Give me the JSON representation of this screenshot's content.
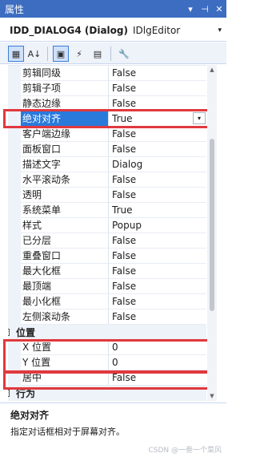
{
  "window": {
    "title": "属性",
    "btn_pin_menu": "▾",
    "btn_pin": "⊣",
    "btn_close": "✕"
  },
  "object": {
    "name": "IDD_DIALOG4 (Dialog)",
    "type": "IDlgEditor",
    "caret": "▾"
  },
  "toolbar": {
    "buttons": [
      {
        "icon": "categorized-icon",
        "glyph": "▦",
        "active": true
      },
      {
        "icon": "alphabetical-icon",
        "glyph": "A↓",
        "active": false
      },
      {
        "icon": "properties-icon",
        "glyph": "▣",
        "active": true
      },
      {
        "icon": "events-icon",
        "glyph": "⚡",
        "active": false
      },
      {
        "icon": "messages-icon",
        "glyph": "▤",
        "active": false
      },
      {
        "icon": "wrench-icon",
        "glyph": "🔧",
        "active": false
      }
    ]
  },
  "grid": {
    "group1_rows": [
      {
        "name": "剪辑同级",
        "value": "False"
      },
      {
        "name": "剪辑子项",
        "value": "False"
      },
      {
        "name": "静态边缘",
        "value": "False"
      },
      {
        "name": "绝对对齐",
        "value": "True",
        "selected": true,
        "dropdown": "▾"
      },
      {
        "name": "客户端边缘",
        "value": "False"
      },
      {
        "name": "面板窗口",
        "value": "False"
      },
      {
        "name": "描述文字",
        "value": "Dialog"
      },
      {
        "name": "水平滚动条",
        "value": "False"
      },
      {
        "name": "透明",
        "value": "False"
      },
      {
        "name": "系统菜单",
        "value": "True"
      },
      {
        "name": "样式",
        "value": "Popup"
      },
      {
        "name": "已分层",
        "value": "False"
      },
      {
        "name": "重叠窗口",
        "value": "False"
      },
      {
        "name": "最大化框",
        "value": "False"
      },
      {
        "name": "最顶端",
        "value": "False"
      },
      {
        "name": "最小化框",
        "value": "False"
      },
      {
        "name": "左侧滚动条",
        "value": "False"
      }
    ],
    "category_position": {
      "label": "位置",
      "toggle": "−"
    },
    "position_rows": [
      {
        "name": "X 位置",
        "value": "0"
      },
      {
        "name": "Y 位置",
        "value": "0"
      },
      {
        "name": "居中",
        "value": "False"
      }
    ],
    "category_behavior": {
      "label": "行为",
      "toggle": "−"
    }
  },
  "description": {
    "title": "绝对对齐",
    "text": "指定对话框相对于屏幕对齐。"
  },
  "watermark": "CSDN @一叁一个菜风",
  "colors": {
    "title_bar": "#3c6dc1",
    "selection": "#2a7adb",
    "highlight_box": "#e0393e"
  }
}
